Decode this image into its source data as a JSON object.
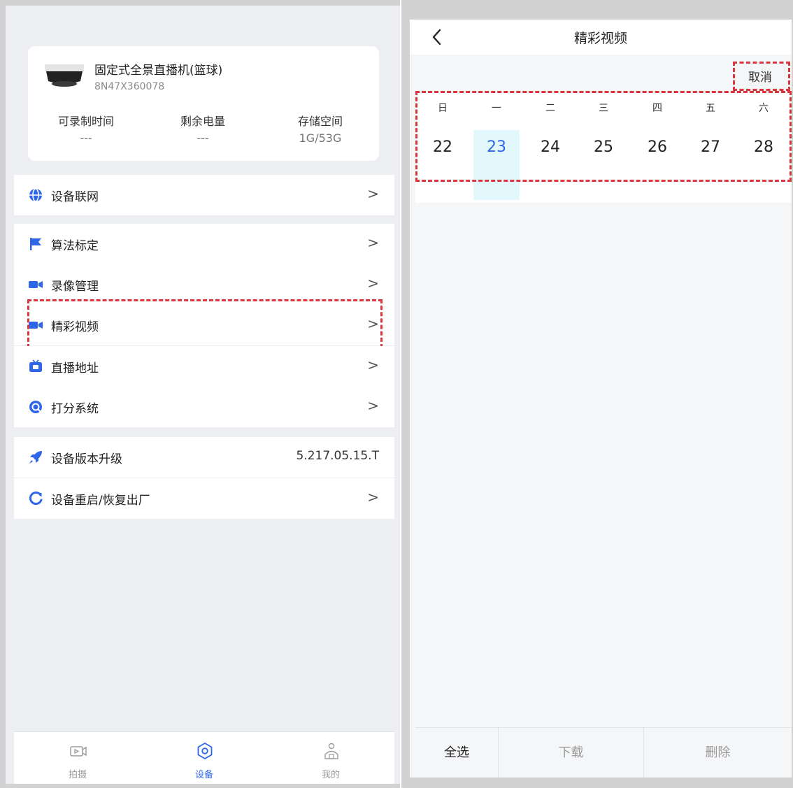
{
  "left": {
    "device": {
      "name": "固定式全景直播机(篮球)",
      "serial": "8N47X360078",
      "stats": [
        {
          "label": "可录制时间",
          "value": "---"
        },
        {
          "label": "剩余电量",
          "value": "---"
        },
        {
          "label": "存储空间",
          "value": "1G/53G"
        }
      ]
    },
    "menu": {
      "network": {
        "label": "设备联网",
        "icon": "globe-icon"
      },
      "calibration": {
        "label": "算法标定",
        "icon": "flag-icon"
      },
      "recording": {
        "label": "录像管理",
        "icon": "video-camera-icon"
      },
      "highlights": {
        "label": "精彩视频",
        "icon": "video-camera-icon"
      },
      "live": {
        "label": "直播地址",
        "icon": "live-tv-icon"
      },
      "scoring": {
        "label": "打分系统",
        "icon": "scoreboard-icon"
      },
      "upgrade": {
        "label": "设备版本升级",
        "value": "5.217.05.15.T",
        "icon": "rocket-icon"
      },
      "reboot": {
        "label": "设备重启/恢复出厂",
        "icon": "refresh-icon"
      }
    },
    "chevron": ">",
    "tabs": [
      {
        "label": "拍摄",
        "icon": "camera-tab-icon",
        "active": false
      },
      {
        "label": "设备",
        "icon": "settings-tab-icon",
        "active": true
      },
      {
        "label": "我的",
        "icon": "profile-tab-icon",
        "active": false
      }
    ]
  },
  "right": {
    "title": "精彩视频",
    "cancel": "取消",
    "weekdays": [
      "日",
      "一",
      "二",
      "三",
      "四",
      "五",
      "六"
    ],
    "days": [
      "22",
      "23",
      "24",
      "25",
      "26",
      "27",
      "28"
    ],
    "selected_day": "23",
    "bottom": {
      "select_all": "全选",
      "download": "下载",
      "delete": "删除"
    }
  },
  "colors": {
    "accent": "#2f66e8",
    "highlight_bg": "#e3f8fd",
    "annotation_red": "#d9363e",
    "disabled_text": "#9b9b9b"
  }
}
